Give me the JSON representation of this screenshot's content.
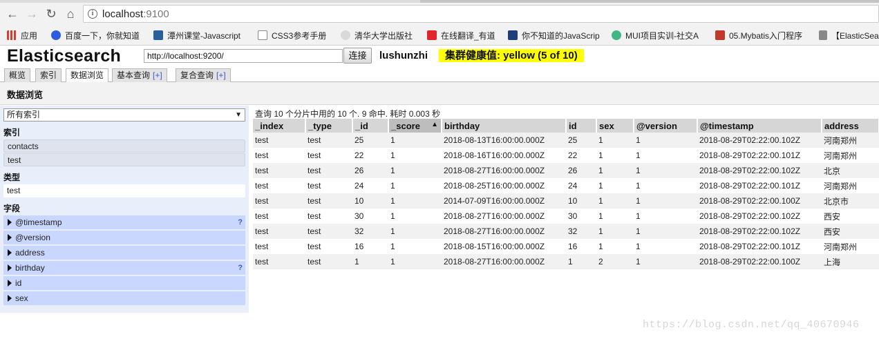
{
  "browser": {
    "url_host": "localhost",
    "url_port": ":9100",
    "bookmarks": [
      {
        "label": "应用",
        "icon": "apps-grid-icon",
        "color": "#d23f31"
      },
      {
        "label": "百度一下，你就知道",
        "icon": "baidu-paw-icon",
        "color": "#2f5be0"
      },
      {
        "label": "潭州课堂-Javascript",
        "icon": "tanzhou-icon",
        "color": "#2a5f9e"
      },
      {
        "label": "CSS3参考手册",
        "icon": "page-icon",
        "color": "#888888"
      },
      {
        "label": "清华大学出版社",
        "icon": "tsinghua-icon",
        "color": "#7a7a7a"
      },
      {
        "label": "在线翻译_有道",
        "icon": "youdao-icon",
        "color": "#e0262b"
      },
      {
        "label": "你不知道的JavaScrip",
        "icon": "js-book-icon",
        "color": "#1f3d7a"
      },
      {
        "label": "MUI项目实训-社交A",
        "icon": "vue-icon",
        "color": "#41b883"
      },
      {
        "label": "05.Mybatis入门程序",
        "icon": "mybatis-icon",
        "color": "#c0392b"
      },
      {
        "label": "【ElasticSearch",
        "icon": "bookmark-folder-icon",
        "color": "#555555"
      }
    ]
  },
  "app": {
    "title": "Elasticsearch",
    "connect_url": "http://localhost:9200/",
    "connect_label": "连接",
    "cluster_name": "lushunzhi",
    "health": "集群健康值: yellow (5 of 10)",
    "health_color": "#ffff00"
  },
  "tabs": [
    {
      "label": "概览",
      "plus": ""
    },
    {
      "label": "索引",
      "plus": ""
    },
    {
      "label": "数据浏览",
      "plus": ""
    },
    {
      "label": "基本查询",
      "plus": "[+]"
    },
    {
      "label": "复合查询",
      "plus": "[+]"
    }
  ],
  "page_title": "数据浏览",
  "sidebar": {
    "index_select": "所有索引",
    "indices_heading": "索引",
    "indices": [
      "contacts",
      "test"
    ],
    "types_heading": "类型",
    "types": [
      "test"
    ],
    "fields_heading": "字段",
    "fields": [
      {
        "name": "@timestamp",
        "help": "?"
      },
      {
        "name": "@version",
        "help": ""
      },
      {
        "name": "address",
        "help": ""
      },
      {
        "name": "birthday",
        "help": "?"
      },
      {
        "name": "id",
        "help": ""
      },
      {
        "name": "sex",
        "help": ""
      }
    ]
  },
  "results": {
    "summary": "查询 10 个分片中用的 10 个. 9 命中. 耗时 0.003 秒",
    "columns": [
      "_index",
      "_type",
      "_id",
      "_score",
      "birthday",
      "id",
      "sex",
      "@version",
      "@timestamp",
      "address"
    ],
    "sort_arrow": "▲",
    "rows": [
      [
        "test",
        "test",
        "25",
        "1",
        "2018-08-13T16:00:00.000Z",
        "25",
        "1",
        "1",
        "2018-08-29T02:22:00.102Z",
        "河南郑州"
      ],
      [
        "test",
        "test",
        "22",
        "1",
        "2018-08-16T16:00:00.000Z",
        "22",
        "1",
        "1",
        "2018-08-29T02:22:00.101Z",
        "河南郑州"
      ],
      [
        "test",
        "test",
        "26",
        "1",
        "2018-08-27T16:00:00.000Z",
        "26",
        "1",
        "1",
        "2018-08-29T02:22:00.102Z",
        "北京"
      ],
      [
        "test",
        "test",
        "24",
        "1",
        "2018-08-25T16:00:00.000Z",
        "24",
        "1",
        "1",
        "2018-08-29T02:22:00.101Z",
        "河南郑州"
      ],
      [
        "test",
        "test",
        "10",
        "1",
        "2014-07-09T16:00:00.000Z",
        "10",
        "1",
        "1",
        "2018-08-29T02:22:00.100Z",
        "北京市"
      ],
      [
        "test",
        "test",
        "30",
        "1",
        "2018-08-27T16:00:00.000Z",
        "30",
        "1",
        "1",
        "2018-08-29T02:22:00.102Z",
        "西安"
      ],
      [
        "test",
        "test",
        "32",
        "1",
        "2018-08-27T16:00:00.000Z",
        "32",
        "1",
        "1",
        "2018-08-29T02:22:00.102Z",
        "西安"
      ],
      [
        "test",
        "test",
        "16",
        "1",
        "2018-08-15T16:00:00.000Z",
        "16",
        "1",
        "1",
        "2018-08-29T02:22:00.101Z",
        "河南郑州"
      ],
      [
        "test",
        "test",
        "1",
        "1",
        "2018-08-27T16:00:00.000Z",
        "1",
        "2",
        "1",
        "2018-08-29T02:22:00.100Z",
        "上海"
      ]
    ]
  },
  "watermark": "https://blog.csdn.net/qq_40670946"
}
